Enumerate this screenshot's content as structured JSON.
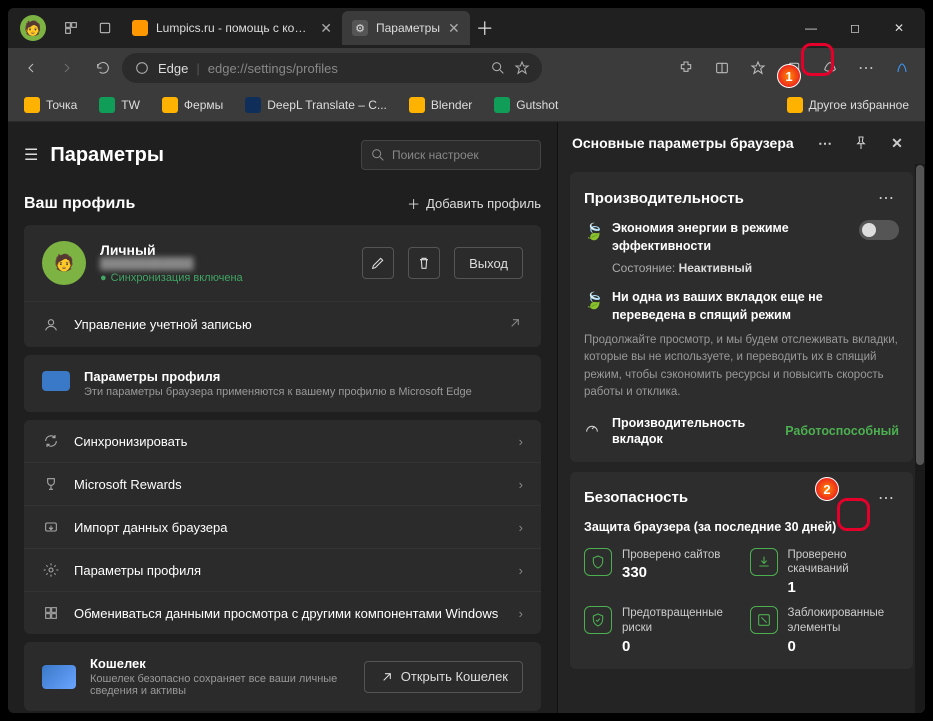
{
  "tabs": [
    {
      "title": "Lumpics.ru - помощь с компьюте",
      "favicon": "#ff9800"
    },
    {
      "title": "Параметры",
      "favicon": "#888"
    }
  ],
  "toolbar": {
    "edge_label": "Edge",
    "url_path": "edge://settings/profiles"
  },
  "bookmarks": {
    "items": [
      {
        "label": "Точка",
        "color": "#ffb300"
      },
      {
        "label": "TW",
        "color": "#0f9d58"
      },
      {
        "label": "Фермы",
        "color": "#ffb300"
      },
      {
        "label": "DeepL Translate – C...",
        "color": "#0f2e5a"
      },
      {
        "label": "Blender",
        "color": "#ffb300"
      },
      {
        "label": "Gutshot",
        "color": "#0f9d58"
      }
    ],
    "more": "Другое избранное"
  },
  "settings": {
    "title": "Параметры",
    "search_placeholder": "Поиск настроек",
    "profile_section": "Ваш профиль",
    "add_profile": "Добавить профиль",
    "profile_name": "Личный",
    "sync_on": "Синхронизация включена",
    "logout": "Выход",
    "manage_account": "Управление учетной записью",
    "profile_params_title": "Параметры профиля",
    "profile_params_desc": "Эти параметры браузера применяются к вашему профилю в Microsoft Edge",
    "items": {
      "sync": "Синхронизировать",
      "rewards": "Microsoft Rewards",
      "import": "Импорт данных браузера",
      "profile": "Параметры профиля",
      "share": "Обмениваться данными просмотра с другими компонентами Windows"
    },
    "wallet_title": "Кошелек",
    "wallet_desc": "Кошелек безопасно сохраняет все ваши личные сведения и активы",
    "wallet_open": "Открыть Кошелек"
  },
  "panel": {
    "title": "Основные параметры браузера",
    "perf": {
      "title": "Производительность",
      "energy": "Экономия энергии в режиме эффективности",
      "status_label": "Состояние:",
      "status_value": "Неактивный",
      "sleep_title": "Ни одна из ваших вкладок еще не переведена в спящий режим",
      "sleep_desc": "Продолжайте просмотр, и мы будем отслеживать вкладки, которые вы не используете, и переводить их в спящий режим, чтобы сэкономить ресурсы и повысить скорость работы и отклика.",
      "tab_perf_label": "Производительность вкладок",
      "tab_perf_value": "Работоспособный"
    },
    "sec": {
      "title": "Безопасность",
      "subtitle": "Защита браузера (за последние 30 дней)",
      "sites_label": "Проверено сайтов",
      "sites_value": "330",
      "downloads_label": "Проверено скачиваний",
      "downloads_value": "1",
      "risks_label": "Предотвращенные риски",
      "risks_value": "0",
      "blocked_label": "Заблокированные элементы",
      "blocked_value": "0"
    }
  },
  "annotations": {
    "m1": "1",
    "m2": "2"
  }
}
